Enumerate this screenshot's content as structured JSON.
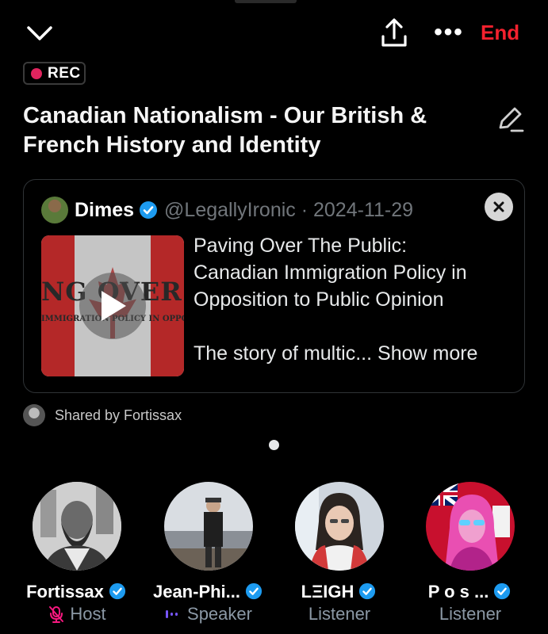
{
  "header": {
    "end_label": "End",
    "more_label": "•••"
  },
  "rec_label": "REC",
  "space_title": "Canadian Nationalism - Our British & French History and Identity",
  "shared_post": {
    "author_name": "Dimes",
    "handle_date": "@LegallyIronic · 2024-11-29",
    "thumbnail_text": "NG OVER THE PU",
    "thumbnail_subtext": "IMMIGRATION POLICY IN OPPOSITION TO PUB",
    "text_line1": "Paving Over The Public:",
    "text_line2": "Canadian Immigration Policy in",
    "text_line3": "Opposition to Public Opinion",
    "snippet": "The story of multic... ",
    "show_more": "Show more"
  },
  "shared_by": "Shared by Fortissax",
  "participants": [
    {
      "name": "Fortissax",
      "role": "Host",
      "verified": true
    },
    {
      "name": "Jean-Phi...",
      "role": "Speaker",
      "verified": true
    },
    {
      "name": "LΞIGH",
      "role": "Listener",
      "verified": true
    },
    {
      "name": "P o s ...",
      "role": "Listener",
      "verified": true
    }
  ],
  "colors": {
    "accent_red": "#f4212e",
    "verified_blue": "#1d9bf0",
    "rec_dot": "#e0245e",
    "host_icon": "#f91880",
    "speaker_icon": "#7856ff"
  },
  "icons": [
    "chevron-down-icon",
    "share-icon",
    "more-icon",
    "edit-icon",
    "close-icon",
    "play-icon",
    "verified-icon",
    "mic-off-icon",
    "audio-icon"
  ]
}
